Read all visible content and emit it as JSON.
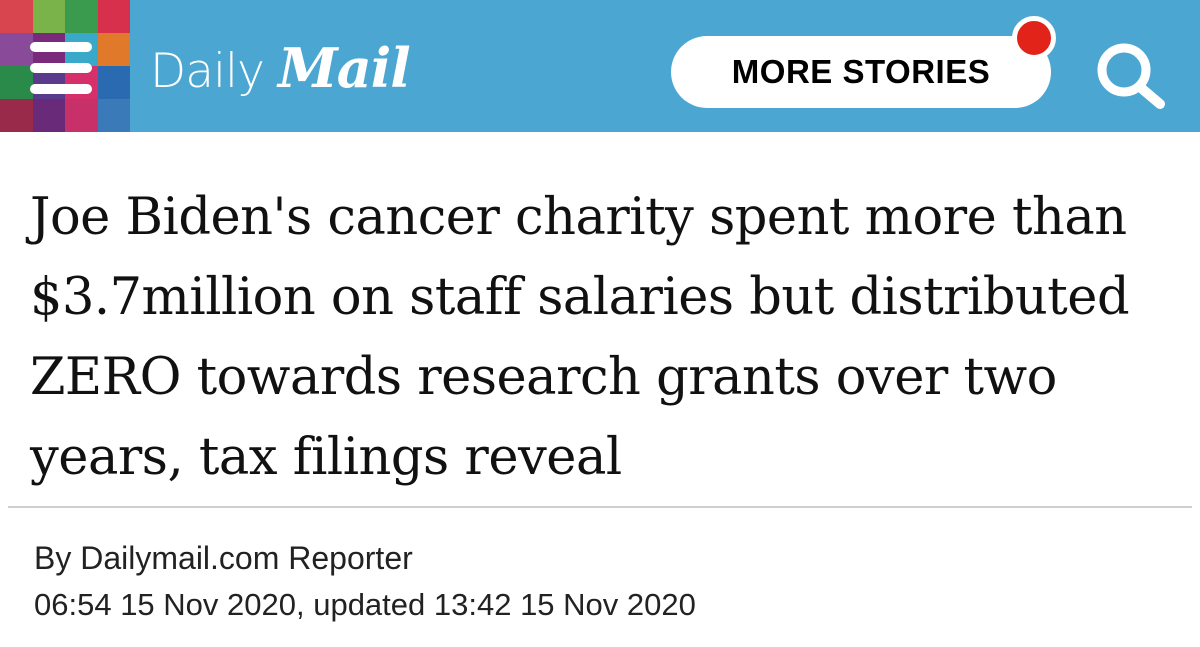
{
  "header": {
    "logo_daily": "Daily",
    "logo_mail": "Mail",
    "more_stories": "MORE STORIES",
    "menu_tile_colors": [
      "#d8454e",
      "#7ab34a",
      "#3a9a4d",
      "#d6304c",
      "#8a4a9a",
      "#7a2a7a",
      "#3aa8c8",
      "#e07a2a",
      "#2a8a4a",
      "#5a3a8a",
      "#d6306a",
      "#2a6ab0",
      "#9a2a4a",
      "#6a2a7a",
      "#c8306a",
      "#3a7ab8"
    ],
    "accent_color": "#4ba7d2",
    "notification_color": "#e2231a"
  },
  "article": {
    "headline": "Joe Biden's cancer charity spent more than $3.7million on staff salaries but distributed ZERO towards research grants over two years, tax filings reveal",
    "byline": "By Dailymail.com Reporter",
    "timestamp": "06:54 15 Nov 2020, updated 13:42 15 Nov 2020"
  }
}
